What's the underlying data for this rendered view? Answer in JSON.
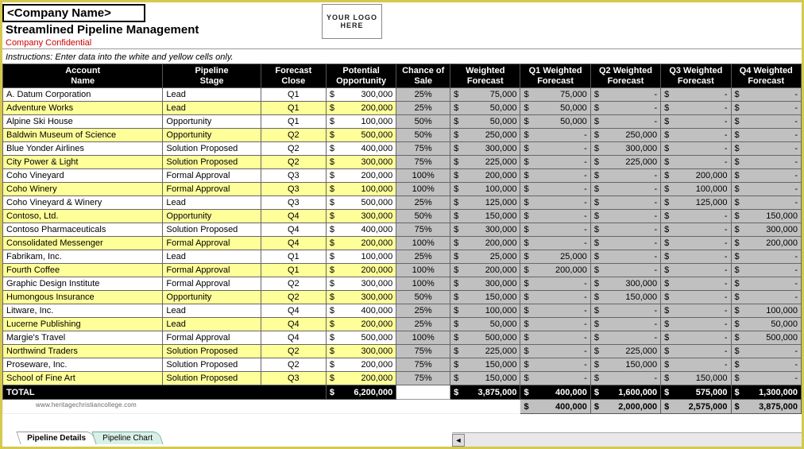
{
  "header": {
    "company_name": "<Company Name>",
    "title": "Streamlined Pipeline Management",
    "confidential": "Company Confidential",
    "logo_text": "YOUR LOGO HERE",
    "instructions": "Instructions: Enter data into the white and yellow cells only."
  },
  "columns": [
    "Account Name",
    "Pipeline Stage",
    "Forecast Close",
    "Potential Opportunity",
    "Chance of Sale",
    "Weighted Forecast",
    "Q1 Weighted Forecast",
    "Q2 Weighted Forecast",
    "Q3 Weighted Forecast",
    "Q4 Weighted Forecast"
  ],
  "rows": [
    {
      "account": "A. Datum Corporation",
      "stage": "Lead",
      "close": "Q1",
      "pot": "300,000",
      "chance": "25%",
      "wf": "75,000",
      "q1": "75,000",
      "q2": "-",
      "q3": "-",
      "q4": "-"
    },
    {
      "account": "Adventure Works",
      "stage": "Lead",
      "close": "Q1",
      "pot": "200,000",
      "chance": "25%",
      "wf": "50,000",
      "q1": "50,000",
      "q2": "-",
      "q3": "-",
      "q4": "-"
    },
    {
      "account": "Alpine Ski House",
      "stage": "Opportunity",
      "close": "Q1",
      "pot": "100,000",
      "chance": "50%",
      "wf": "50,000",
      "q1": "50,000",
      "q2": "-",
      "q3": "-",
      "q4": "-"
    },
    {
      "account": "Baldwin Museum of Science",
      "stage": "Opportunity",
      "close": "Q2",
      "pot": "500,000",
      "chance": "50%",
      "wf": "250,000",
      "q1": "-",
      "q2": "250,000",
      "q3": "-",
      "q4": "-"
    },
    {
      "account": "Blue Yonder Airlines",
      "stage": "Solution Proposed",
      "close": "Q2",
      "pot": "400,000",
      "chance": "75%",
      "wf": "300,000",
      "q1": "-",
      "q2": "300,000",
      "q3": "-",
      "q4": "-"
    },
    {
      "account": "City Power & Light",
      "stage": "Solution Proposed",
      "close": "Q2",
      "pot": "300,000",
      "chance": "75%",
      "wf": "225,000",
      "q1": "-",
      "q2": "225,000",
      "q3": "-",
      "q4": "-"
    },
    {
      "account": "Coho Vineyard",
      "stage": "Formal Approval",
      "close": "Q3",
      "pot": "200,000",
      "chance": "100%",
      "wf": "200,000",
      "q1": "-",
      "q2": "-",
      "q3": "200,000",
      "q4": "-"
    },
    {
      "account": "Coho Winery",
      "stage": "Formal Approval",
      "close": "Q3",
      "pot": "100,000",
      "chance": "100%",
      "wf": "100,000",
      "q1": "-",
      "q2": "-",
      "q3": "100,000",
      "q4": "-"
    },
    {
      "account": "Coho Vineyard & Winery",
      "stage": "Lead",
      "close": "Q3",
      "pot": "500,000",
      "chance": "25%",
      "wf": "125,000",
      "q1": "-",
      "q2": "-",
      "q3": "125,000",
      "q4": "-"
    },
    {
      "account": "Contoso, Ltd.",
      "stage": "Opportunity",
      "close": "Q4",
      "pot": "300,000",
      "chance": "50%",
      "wf": "150,000",
      "q1": "-",
      "q2": "-",
      "q3": "-",
      "q4": "150,000"
    },
    {
      "account": "Contoso Pharmaceuticals",
      "stage": "Solution Proposed",
      "close": "Q4",
      "pot": "400,000",
      "chance": "75%",
      "wf": "300,000",
      "q1": "-",
      "q2": "-",
      "q3": "-",
      "q4": "300,000"
    },
    {
      "account": "Consolidated Messenger",
      "stage": "Formal Approval",
      "close": "Q4",
      "pot": "200,000",
      "chance": "100%",
      "wf": "200,000",
      "q1": "-",
      "q2": "-",
      "q3": "-",
      "q4": "200,000"
    },
    {
      "account": "Fabrikam, Inc.",
      "stage": "Lead",
      "close": "Q1",
      "pot": "100,000",
      "chance": "25%",
      "wf": "25,000",
      "q1": "25,000",
      "q2": "-",
      "q3": "-",
      "q4": "-"
    },
    {
      "account": "Fourth Coffee",
      "stage": "Formal Approval",
      "close": "Q1",
      "pot": "200,000",
      "chance": "100%",
      "wf": "200,000",
      "q1": "200,000",
      "q2": "-",
      "q3": "-",
      "q4": "-"
    },
    {
      "account": "Graphic Design Institute",
      "stage": "Formal Approval",
      "close": "Q2",
      "pot": "300,000",
      "chance": "100%",
      "wf": "300,000",
      "q1": "-",
      "q2": "300,000",
      "q3": "-",
      "q4": "-"
    },
    {
      "account": "Humongous Insurance",
      "stage": "Opportunity",
      "close": "Q2",
      "pot": "300,000",
      "chance": "50%",
      "wf": "150,000",
      "q1": "-",
      "q2": "150,000",
      "q3": "-",
      "q4": "-"
    },
    {
      "account": "Litware, Inc.",
      "stage": "Lead",
      "close": "Q4",
      "pot": "400,000",
      "chance": "25%",
      "wf": "100,000",
      "q1": "-",
      "q2": "-",
      "q3": "-",
      "q4": "100,000"
    },
    {
      "account": "Lucerne Publishing",
      "stage": "Lead",
      "close": "Q4",
      "pot": "200,000",
      "chance": "25%",
      "wf": "50,000",
      "q1": "-",
      "q2": "-",
      "q3": "-",
      "q4": "50,000"
    },
    {
      "account": "Margie's Travel",
      "stage": "Formal Approval",
      "close": "Q4",
      "pot": "500,000",
      "chance": "100%",
      "wf": "500,000",
      "q1": "-",
      "q2": "-",
      "q3": "-",
      "q4": "500,000"
    },
    {
      "account": "Northwind Traders",
      "stage": "Solution Proposed",
      "close": "Q2",
      "pot": "300,000",
      "chance": "75%",
      "wf": "225,000",
      "q1": "-",
      "q2": "225,000",
      "q3": "-",
      "q4": "-"
    },
    {
      "account": "Proseware, Inc.",
      "stage": "Solution Proposed",
      "close": "Q2",
      "pot": "200,000",
      "chance": "75%",
      "wf": "150,000",
      "q1": "-",
      "q2": "150,000",
      "q3": "-",
      "q4": "-"
    },
    {
      "account": "School of Fine Art",
      "stage": "Solution Proposed",
      "close": "Q3",
      "pot": "200,000",
      "chance": "75%",
      "wf": "150,000",
      "q1": "-",
      "q2": "-",
      "q3": "150,000",
      "q4": "-"
    }
  ],
  "total": {
    "label": "TOTAL",
    "pot": "6,200,000",
    "wf": "3,875,000",
    "q1": "400,000",
    "q2": "1,600,000",
    "q3": "575,000",
    "q4": "1,300,000"
  },
  "grand": {
    "q1": "400,000",
    "q2": "2,000,000",
    "q3": "2,575,000",
    "q4": "3,875,000"
  },
  "watermark": "www.heritagechristiancollege.com",
  "tabs": {
    "active": "Pipeline Details",
    "other": "Pipeline Chart"
  }
}
